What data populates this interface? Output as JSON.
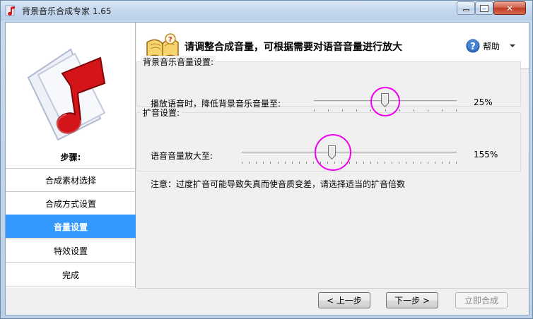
{
  "window": {
    "title": "背景音乐合成专家 1.65",
    "close_glyph": "✕"
  },
  "sidebar": {
    "steps_title": "步骤:",
    "items": [
      {
        "label": "合成素材选择",
        "active": false
      },
      {
        "label": "合成方式设置",
        "active": false
      },
      {
        "label": "音量设置",
        "active": true
      },
      {
        "label": "特效设置",
        "active": false
      },
      {
        "label": "完成",
        "active": false
      }
    ]
  },
  "header": {
    "instruction": "请调整合成音量，可根据需要对语音音量进行放大",
    "help_label": "帮助"
  },
  "bgm_group": {
    "title": "背景音乐音量设置:",
    "row_label": "播放语音时，降低背景音乐音量至:",
    "value_text": "25%",
    "value": 25
  },
  "amp_group": {
    "title": "扩音设置:",
    "row_label": "语音音量放大至:",
    "value_text": "155%",
    "value": 155,
    "note": "注意：过度扩音可能导致失真而使音质变差，请选择适当的扩音倍数"
  },
  "buttons": {
    "prev": "< 上一步",
    "next": "下一步 >",
    "compose": "立即合成"
  },
  "colors": {
    "active_step": "#3399ff",
    "highlight_circle": "#ee00ee",
    "logo_red": "#d3151a"
  }
}
